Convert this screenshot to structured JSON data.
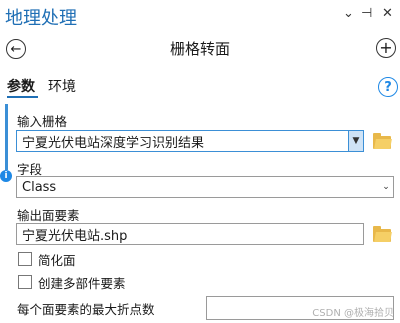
{
  "panel": {
    "title": "地理处理",
    "controls": {
      "menu": "⌄",
      "pin": "⊣",
      "close": "✕"
    }
  },
  "tool": {
    "title": "栅格转面",
    "back_icon": "←",
    "add_icon": "+"
  },
  "tabs": [
    {
      "label": "参数"
    },
    {
      "label": "环境"
    }
  ],
  "help": {
    "icon": "?"
  },
  "params": {
    "input_raster": {
      "label": "输入栅格",
      "value": "宁夏光伏电站深度学习识别结果"
    },
    "field": {
      "label": "字段",
      "value": "Class"
    },
    "output": {
      "label": "输出面要素",
      "value": "宁夏光伏电站.shp"
    },
    "simplify": {
      "label": "简化面",
      "checked": false
    },
    "multipart": {
      "label": "创建多部件要素",
      "checked": false
    },
    "max_vertices": {
      "label": "每个面要素的最大折点数",
      "value": ""
    }
  },
  "info_icon": "i",
  "watermark": "CSDN @极海拾贝",
  "colors": {
    "accent": "#1f6fb5",
    "focus": "#3b8fd6",
    "folder": "#e8b84a"
  }
}
